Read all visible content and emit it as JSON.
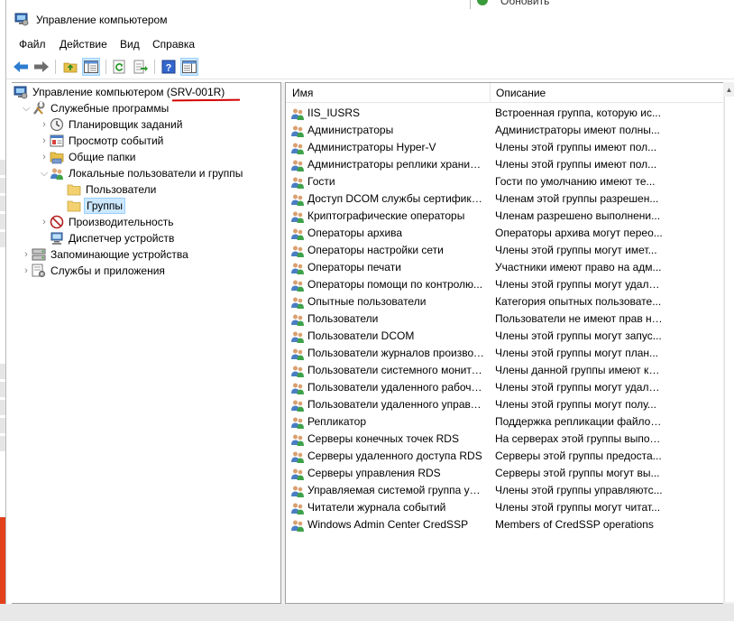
{
  "window": {
    "title": "Управление компьютером",
    "background_window_label": "Обновить"
  },
  "menu": [
    "Файл",
    "Действие",
    "Вид",
    "Справка"
  ],
  "toolbar": {
    "buttons": [
      "back-arrow-icon",
      "forward-arrow-icon",
      "up-folder-icon",
      "show-hide-console-tree-icon",
      "refresh-icon",
      "export-list-icon",
      "help-icon",
      "action-pane-icon"
    ]
  },
  "tree": {
    "root": "Управление компьютером (SRV-001R)",
    "items": [
      {
        "label": "Служебные программы",
        "icon": "tools-icon"
      },
      {
        "label": "Планировщик заданий",
        "icon": "clock-icon"
      },
      {
        "label": "Просмотр событий",
        "icon": "event-viewer-icon"
      },
      {
        "label": "Общие папки",
        "icon": "shared-folder-icon"
      },
      {
        "label": "Локальные пользователи и группы",
        "icon": "users-icon"
      },
      {
        "label": "Пользователи",
        "icon": "folder-icon"
      },
      {
        "label": "Группы",
        "icon": "folder-icon"
      },
      {
        "label": "Производительность",
        "icon": "performance-icon"
      },
      {
        "label": "Диспетчер устройств",
        "icon": "device-manager-icon"
      },
      {
        "label": "Запоминающие устройства",
        "icon": "storage-icon"
      },
      {
        "label": "Службы и приложения",
        "icon": "services-icon"
      }
    ]
  },
  "list": {
    "columns": [
      "Имя",
      "Описание"
    ],
    "rows": [
      {
        "name": "IIS_IUSRS",
        "desc": "Встроенная группа, которую ис..."
      },
      {
        "name": "Администраторы",
        "desc": "Администраторы имеют полны..."
      },
      {
        "name": "Администраторы Hyper-V",
        "desc": "Члены этой группы имеют пол..."
      },
      {
        "name": "Администраторы реплики хранил...",
        "desc": "Члены этой группы имеют пол..."
      },
      {
        "name": "Гости",
        "desc": "Гости по умолчанию имеют те..."
      },
      {
        "name": "Доступ DCOM службы сертифика...",
        "desc": "Членам этой группы разрешен..."
      },
      {
        "name": "Криптографические операторы",
        "desc": "Членам разрешено выполнени..."
      },
      {
        "name": "Операторы архива",
        "desc": "Операторы архива могут перео..."
      },
      {
        "name": "Операторы настройки сети",
        "desc": "Члены этой группы могут имет..."
      },
      {
        "name": "Операторы печати",
        "desc": "Участники имеют право на адм..."
      },
      {
        "name": "Операторы помощи по контролю...",
        "desc": "Члены этой группы могут удале..."
      },
      {
        "name": "Опытные пользователи",
        "desc": "Категория опытных пользовате..."
      },
      {
        "name": "Пользователи",
        "desc": "Пользователи не имеют прав на..."
      },
      {
        "name": "Пользователи DCOM",
        "desc": "Члены этой группы могут запус..."
      },
      {
        "name": "Пользователи журналов производ...",
        "desc": "Члены этой группы могут план..."
      },
      {
        "name": "Пользователи системного монито...",
        "desc": "Члены данной группы имеют ка..."
      },
      {
        "name": "Пользователи удаленного рабоче...",
        "desc": "Члены этой группы могут удале..."
      },
      {
        "name": "Пользователи удаленного управл...",
        "desc": "Члены этой группы могут полу..."
      },
      {
        "name": "Репликатор",
        "desc": "Поддержка репликации файлов..."
      },
      {
        "name": "Серверы конечных точек RDS",
        "desc": "На серверах этой группы выпол..."
      },
      {
        "name": "Серверы удаленного доступа RDS",
        "desc": "Серверы этой группы предоста..."
      },
      {
        "name": "Серверы управления RDS",
        "desc": "Серверы этой группы могут вы..."
      },
      {
        "name": "Управляемая системой группа уче...",
        "desc": "Члены этой группы управляютс..."
      },
      {
        "name": "Читатели журнала событий",
        "desc": "Члены этой группы могут читат..."
      },
      {
        "name": "Windows Admin Center CredSSP",
        "desc": "Members of CredSSP operations"
      }
    ]
  },
  "colors": {
    "selection_bg": "#cce8ff",
    "annotation_red": "#d40000"
  }
}
